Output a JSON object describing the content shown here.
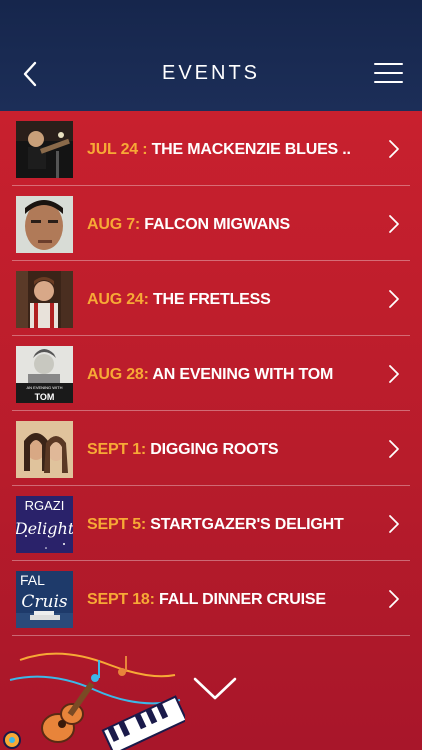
{
  "header": {
    "title": "EVENTS",
    "back_icon": "chevron-left-icon",
    "menu_icon": "hamburger-menu-icon"
  },
  "events": [
    {
      "date": "JUL 24 :",
      "title": " THE MACKENZIE BLUES ..",
      "thumb": "performer-with-guitar-photo"
    },
    {
      "date": "AUG 7:",
      "title": " FALCON MIGWANS",
      "thumb": "man-portrait-photo"
    },
    {
      "date": "AUG 24:",
      "title": " THE FRETLESS",
      "thumb": "musician-with-suspenders-photo"
    },
    {
      "date": "AUG 28:",
      "title": " AN EVENING WITH TOM",
      "thumb": "an-evening-with-tom-poster"
    },
    {
      "date": "SEPT 1:",
      "title": "  DIGGING ROOTS",
      "thumb": "duo-portrait-photo"
    },
    {
      "date": "SEPT 5:",
      "title": " STARTGAZER'S DELIGHT",
      "thumb": "stargazers-delight-poster"
    },
    {
      "date": "SEPT 18:",
      "title": " FALL DINNER CRUISE",
      "thumb": "fall-cruise-poster"
    }
  ],
  "thumb_text": {
    "tom_line": "AN EVENING WITH",
    "tom_name": "TOM",
    "stargazer_top": "RGAZI",
    "stargazer_script": "Delight",
    "fall_top": "FAL",
    "fall_script": "Cruis"
  },
  "footer": {
    "scroll_icon": "chevron-down-icon",
    "decoration": "music-instruments-illustration"
  },
  "colors": {
    "header_bg": "#1a2a52",
    "list_bg": "#c11e2d",
    "date_accent": "#f7a936",
    "text": "#ffffff"
  }
}
